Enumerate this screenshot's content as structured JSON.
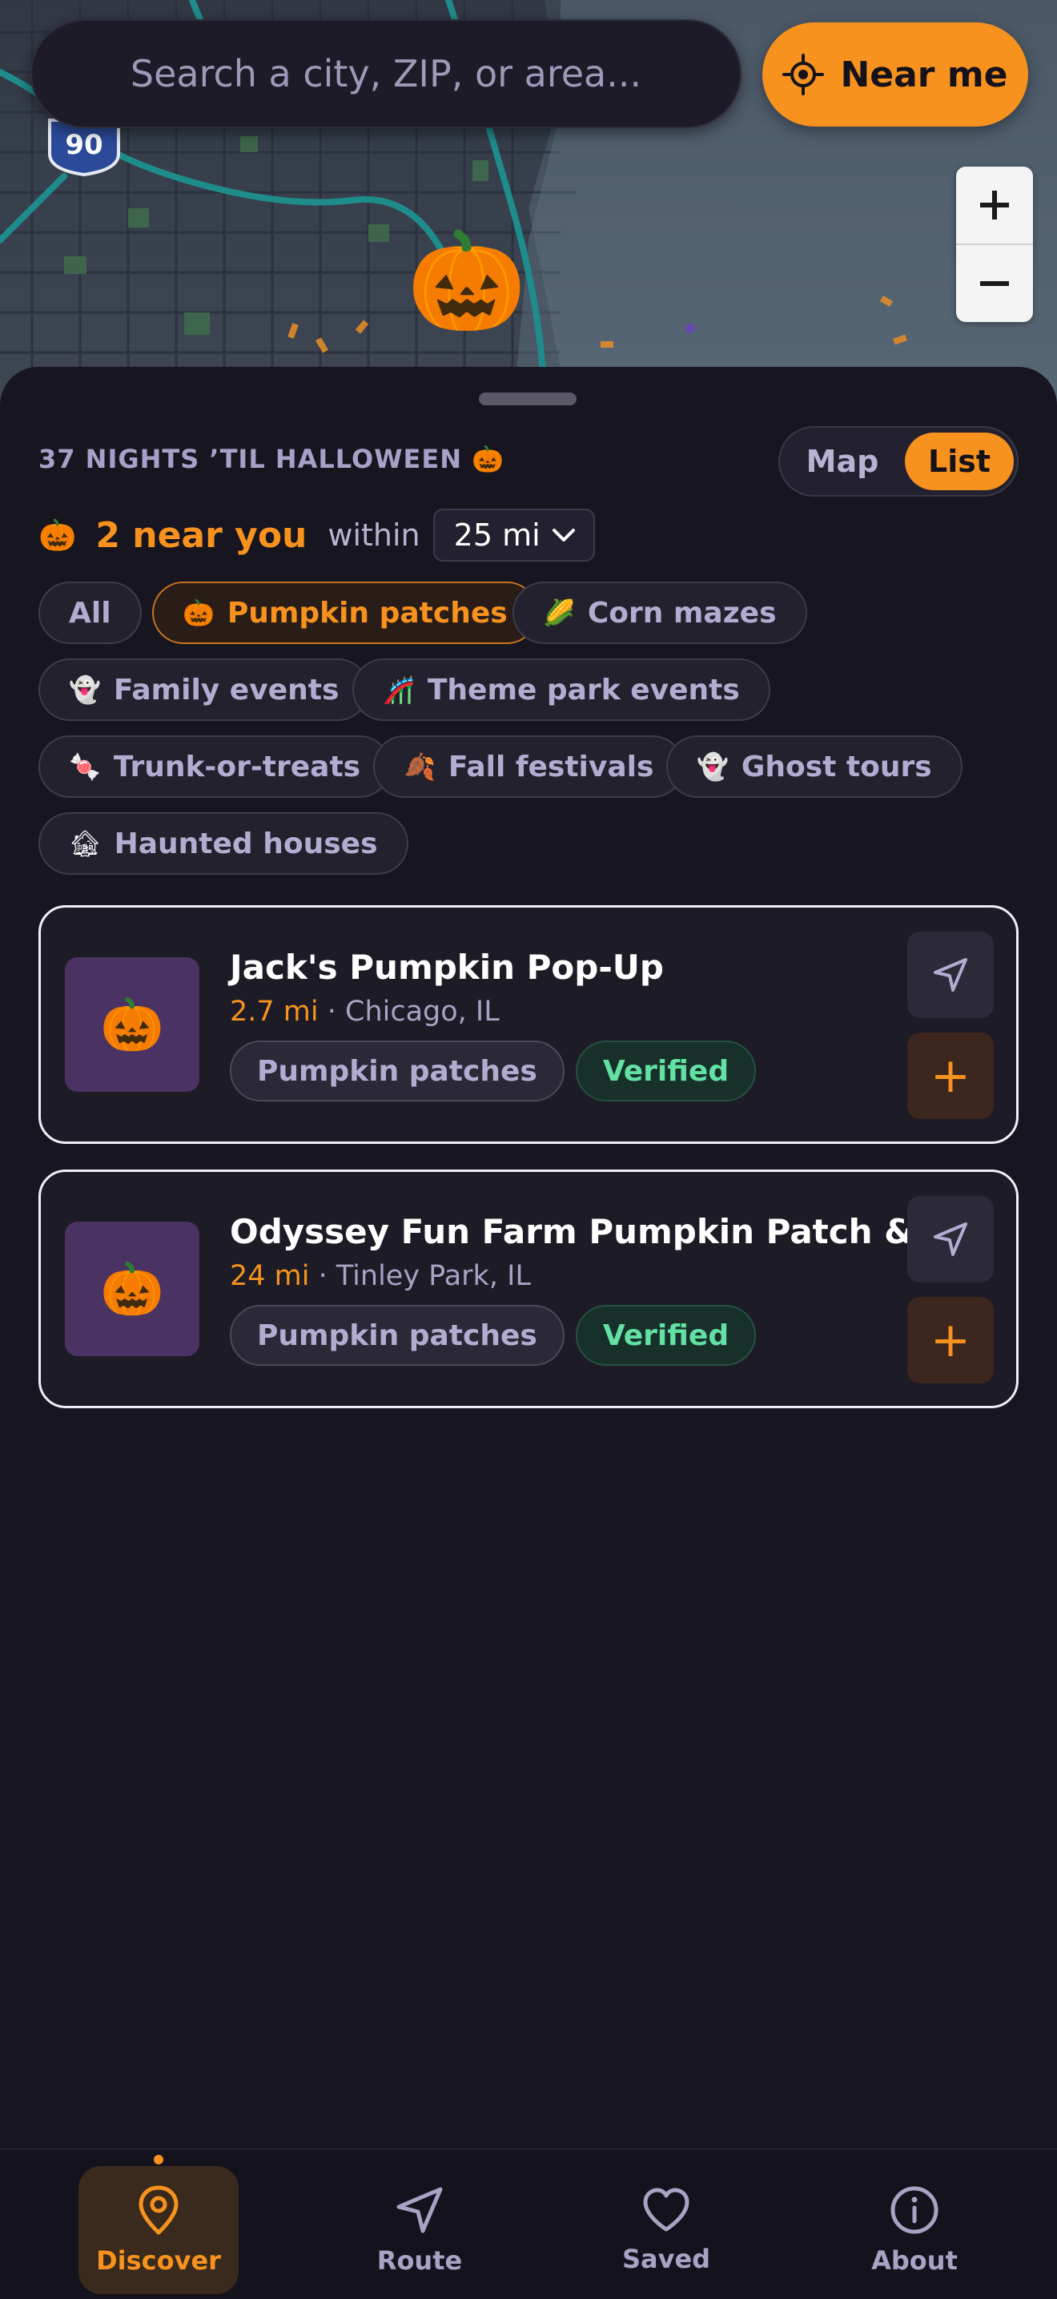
{
  "search": {
    "placeholder": "Search a city, ZIP, or area..."
  },
  "near_me": {
    "label": "Near me",
    "icon": "crosshair-icon"
  },
  "map": {
    "highway_shield": "90",
    "zoom_in": "+",
    "zoom_out": "−",
    "pin": "🎃"
  },
  "countdown": "37 NIGHTS ’TIL HALLOWEEN 🎃",
  "view_toggle": {
    "map": "Map",
    "list": "List",
    "selected": "List"
  },
  "near": {
    "icon": "🎃",
    "count_label": "2 near you",
    "within": "within",
    "radius": "25 mi"
  },
  "filters": [
    {
      "emoji": "",
      "label": "All",
      "active": false
    },
    {
      "emoji": "🎃",
      "label": "Pumpkin patches",
      "active": true
    },
    {
      "emoji": "🌽",
      "label": "Corn mazes",
      "active": false
    },
    {
      "emoji": "👻",
      "label": "Family events",
      "active": false
    },
    {
      "emoji": "🎢",
      "label": "Theme park events",
      "active": false
    },
    {
      "emoji": "🍬",
      "label": "Trunk-or-treats",
      "active": false
    },
    {
      "emoji": "🍂",
      "label": "Fall festivals",
      "active": false
    },
    {
      "emoji": "👻",
      "label": "Ghost tours",
      "active": false
    },
    {
      "emoji": "🏚",
      "label": "Haunted houses",
      "active": false
    }
  ],
  "results": [
    {
      "thumb": "🎃",
      "title": "Jack's Pumpkin Pop-Up",
      "distance": "2.7 mi",
      "separator": " · ",
      "location": "Chicago, IL",
      "category": "Pumpkin patches",
      "badge": "Verified",
      "add": "+"
    },
    {
      "thumb": "🎃",
      "title": "Odyssey Fun Farm Pumpkin Patch & ...",
      "distance": "24 mi",
      "separator": " · ",
      "location": "Tinley Park, IL",
      "category": "Pumpkin patches",
      "badge": "Verified",
      "add": "+"
    }
  ],
  "bottom_nav": [
    {
      "label": "Discover",
      "icon": "map-pin-icon",
      "active": true
    },
    {
      "label": "Route",
      "icon": "navigation-arrow-icon",
      "active": false
    },
    {
      "label": "Saved",
      "icon": "heart-icon",
      "active": false
    },
    {
      "label": "About",
      "icon": "info-icon",
      "active": false
    }
  ],
  "colors": {
    "accent": "#f7921e",
    "background": "#14121f",
    "card": "#1c1b26",
    "verified": "#63e0a3",
    "muted": "#a9a2c4"
  }
}
